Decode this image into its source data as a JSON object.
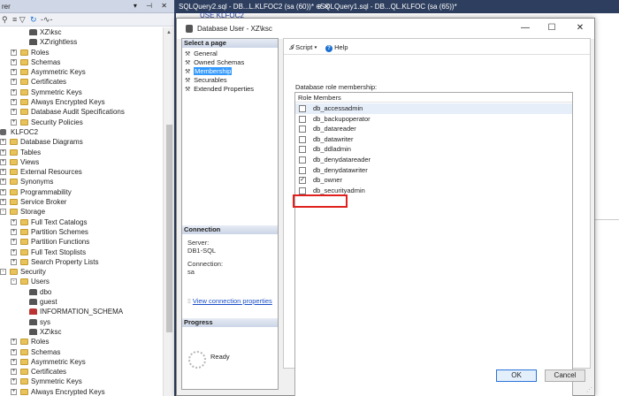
{
  "object_explorer": {
    "title_fragment": "rer",
    "window_controls": "▾ ⊣ ✕",
    "toolbar_icons": [
      "connect-icon",
      "filter-icon",
      "refresh-icon",
      "activity-icon"
    ],
    "tree": [
      {
        "indent": 33,
        "icon": "user",
        "label": "XZ\\ksc"
      },
      {
        "indent": 33,
        "icon": "user",
        "label": "XZ\\rightless"
      },
      {
        "indent": 12,
        "exp": "+",
        "icon": "folder",
        "label": "Roles"
      },
      {
        "indent": 12,
        "exp": "+",
        "icon": "folder",
        "label": "Schemas"
      },
      {
        "indent": 12,
        "exp": "+",
        "icon": "folder",
        "label": "Asymmetric Keys"
      },
      {
        "indent": 12,
        "exp": "+",
        "icon": "folder",
        "label": "Certificates"
      },
      {
        "indent": 12,
        "exp": "+",
        "icon": "folder",
        "label": "Symmetric Keys"
      },
      {
        "indent": 12,
        "exp": "+",
        "icon": "folder",
        "label": "Always Encrypted Keys"
      },
      {
        "indent": 12,
        "exp": "+",
        "icon": "folder",
        "label": "Database Audit Specifications"
      },
      {
        "indent": 12,
        "exp": "+",
        "icon": "folder",
        "label": "Security Policies"
      },
      {
        "indent": 0,
        "icon": "db",
        "label": "KLFOC2"
      },
      {
        "indent": 0,
        "exp": "+",
        "icon": "folder",
        "label": "Database Diagrams"
      },
      {
        "indent": 0,
        "exp": "+",
        "icon": "folder",
        "label": "Tables"
      },
      {
        "indent": 0,
        "exp": "+",
        "icon": "folder",
        "label": "Views"
      },
      {
        "indent": 0,
        "exp": "+",
        "icon": "folder",
        "label": "External Resources"
      },
      {
        "indent": 0,
        "exp": "+",
        "icon": "folder",
        "label": "Synonyms"
      },
      {
        "indent": 0,
        "exp": "+",
        "icon": "folder",
        "label": "Programmability"
      },
      {
        "indent": 0,
        "exp": "+",
        "icon": "folder",
        "label": "Service Broker"
      },
      {
        "indent": 0,
        "exp": "-",
        "icon": "folder",
        "label": "Storage"
      },
      {
        "indent": 12,
        "exp": "+",
        "icon": "folder",
        "label": "Full Text Catalogs"
      },
      {
        "indent": 12,
        "exp": "+",
        "icon": "folder",
        "label": "Partition Schemes"
      },
      {
        "indent": 12,
        "exp": "+",
        "icon": "folder",
        "label": "Partition Functions"
      },
      {
        "indent": 12,
        "exp": "+",
        "icon": "folder",
        "label": "Full Text Stoplists"
      },
      {
        "indent": 12,
        "exp": "+",
        "icon": "folder",
        "label": "Search Property Lists"
      },
      {
        "indent": 0,
        "exp": "-",
        "icon": "folder",
        "label": "Security"
      },
      {
        "indent": 12,
        "exp": "-",
        "icon": "folder",
        "label": "Users"
      },
      {
        "indent": 33,
        "icon": "user",
        "label": "dbo"
      },
      {
        "indent": 33,
        "icon": "user",
        "label": "guest"
      },
      {
        "indent": 33,
        "icon": "user-red",
        "label": "INFORMATION_SCHEMA"
      },
      {
        "indent": 33,
        "icon": "user",
        "label": "sys"
      },
      {
        "indent": 33,
        "icon": "user",
        "label": "XZ\\ksc"
      },
      {
        "indent": 12,
        "exp": "+",
        "icon": "folder",
        "label": "Roles"
      },
      {
        "indent": 12,
        "exp": "+",
        "icon": "folder",
        "label": "Schemas"
      },
      {
        "indent": 12,
        "exp": "+",
        "icon": "folder",
        "label": "Asymmetric Keys"
      },
      {
        "indent": 12,
        "exp": "+",
        "icon": "folder",
        "label": "Certificates"
      },
      {
        "indent": 12,
        "exp": "+",
        "icon": "folder",
        "label": "Symmetric Keys"
      },
      {
        "indent": 12,
        "exp": "+",
        "icon": "folder",
        "label": "Always Encrypted Keys"
      }
    ]
  },
  "tabs": {
    "tab1": "SQLQuery2.sql - DB...L.KLFOC2 (sa (60))*  ⊕  ✕",
    "tab2": "SQLQuery1.sql - DB...QL.KLFOC (sa (65))*",
    "editor_fragment": "USE   KLFOC2"
  },
  "dialog": {
    "title": "Database User - XZ\\ksc",
    "controls": {
      "minimize": "—",
      "maximize": "☐",
      "close": "✕"
    },
    "select_page_header": "Select a page",
    "pages": [
      {
        "label": "General",
        "selected": false
      },
      {
        "label": "Owned Schemas",
        "selected": false
      },
      {
        "label": "Membership",
        "selected": true
      },
      {
        "label": "Securables",
        "selected": false
      },
      {
        "label": "Extended Properties",
        "selected": false
      }
    ],
    "connection_header": "Connection",
    "server_label": "Server:",
    "server_value": "DB1-SQL",
    "connection_label": "Connection:",
    "connection_value": "sa",
    "view_connection_link": "View connection properties",
    "progress_header": "Progress",
    "progress_status": "Ready",
    "toolbar": {
      "script_label": "Script",
      "help_label": "Help"
    },
    "role_caption": "Database role membership:",
    "role_header": "Role Members",
    "roles": [
      {
        "name": "db_accessadmin",
        "checked": false
      },
      {
        "name": "db_backupoperator",
        "checked": false
      },
      {
        "name": "db_datareader",
        "checked": false
      },
      {
        "name": "db_datawriter",
        "checked": false
      },
      {
        "name": "db_ddladmin",
        "checked": false
      },
      {
        "name": "db_denydatareader",
        "checked": false
      },
      {
        "name": "db_denydatawriter",
        "checked": false
      },
      {
        "name": "db_owner",
        "checked": true
      },
      {
        "name": "db_securityadmin",
        "checked": false
      }
    ],
    "ok_label": "OK",
    "cancel_label": "Cancel"
  },
  "colors": {
    "highlight_box": "#e0201e",
    "selection": "#3399ff",
    "link": "#1a4fc7"
  }
}
